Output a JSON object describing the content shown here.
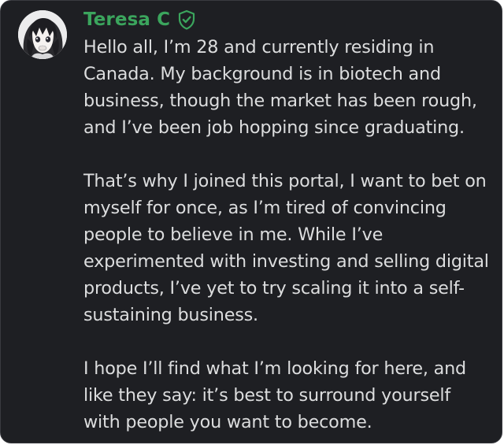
{
  "author": {
    "name": "Teresa C",
    "avatar": "anime-avatar-icon",
    "badge": "verified-shield-check-icon"
  },
  "message": {
    "paragraph_1": [
      "Hello all, I’m 28 and currently residing in",
      "Canada. My background is in biotech and",
      "business, though the market has been rough,",
      "and I’ve been job hopping since graduating."
    ],
    "paragraph_2": [
      "That’s why I joined this portal, I want to bet on",
      "myself for once, as I’m tired of convincing",
      "people to believe in me. While I’ve",
      "experimented with investing and selling digital",
      "products, I’ve yet to try scaling it into a self-",
      "sustaining business."
    ],
    "paragraph_3": [
      "I hope I’ll find what I’m looking for here, and",
      "like they say: it’s best to surround yourself",
      "with people you want to become."
    ]
  },
  "colors": {
    "background": "#1e1f23",
    "username": "#3ba55d",
    "text": "#dcddde"
  }
}
